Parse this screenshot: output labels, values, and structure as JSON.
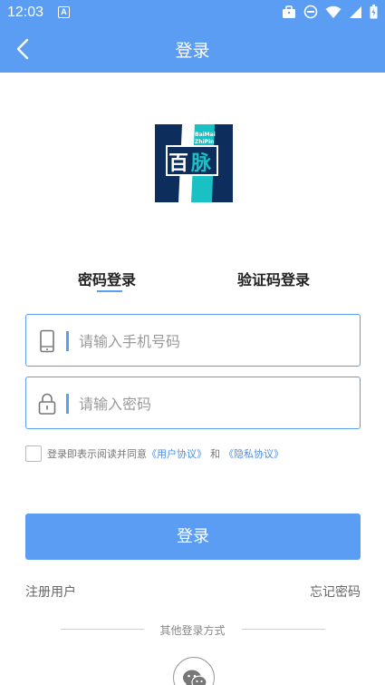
{
  "status_bar": {
    "time": "12:03",
    "notification_badge": "A",
    "icons": [
      "briefcase-icon",
      "do-not-disturb-icon",
      "wifi-icon",
      "signal-icon",
      "battery-icon"
    ]
  },
  "nav": {
    "title": "登录",
    "back_icon": "chevron-left-icon"
  },
  "logo": {
    "line1": "BaiMai",
    "line2": "ZhiPin",
    "glyph1": "百",
    "glyph2": "脉"
  },
  "tabs": {
    "password_login": "密码登录",
    "code_login": "验证码登录",
    "active": "password_login"
  },
  "phone_field": {
    "placeholder": "请输入手机号码",
    "value": "",
    "icon": "phone-icon"
  },
  "password_field": {
    "placeholder": "请输入密码",
    "value": "",
    "icon": "lock-icon"
  },
  "agreement": {
    "checked": false,
    "prefix": "登录即表示阅读并同意",
    "user_agreement": "《用户协议》",
    "conjunction": "和",
    "privacy_agreement": "《隐私协议》"
  },
  "login_button": "登录",
  "register_link": "注册用户",
  "forgot_link": "忘记密码",
  "other_login": "其他登录方式",
  "colors": {
    "primary": "#5b9df3",
    "link": "#4a8ee8",
    "logo_navy": "#0d2d5c",
    "logo_teal": "#19c1c4"
  }
}
